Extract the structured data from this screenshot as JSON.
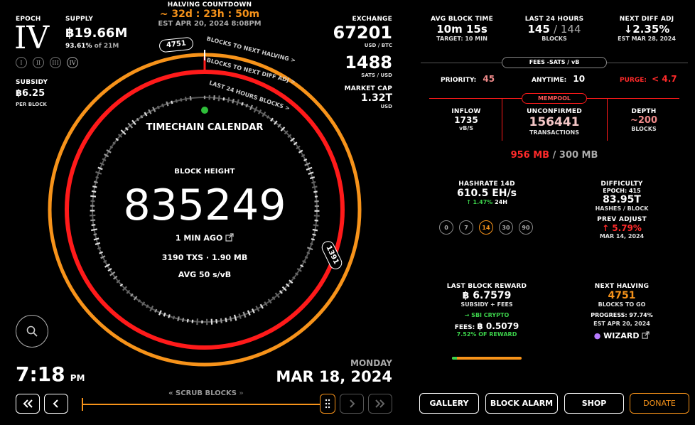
{
  "epoch": {
    "label": "EPOCH",
    "value": "IV",
    "badges": [
      "I",
      "II",
      "III",
      "IV"
    ]
  },
  "supply": {
    "label": "SUPPLY",
    "value": "฿19.66M",
    "pct": "93.61%",
    "of": "of 21M"
  },
  "subsidy": {
    "label": "SUBSIDY",
    "value": "฿6.25",
    "unit": "PER BLOCK"
  },
  "halving": {
    "label": "HALVING COUNTDOWN",
    "countdown": "~ 32d : 23h : 50m",
    "est": "EST APR 20, 2024 8:08PM"
  },
  "exchange": {
    "label": "EXCHANGE",
    "value": "67201",
    "unit": "USD / BTC",
    "sats": "1488",
    "sats_unit": "SATS / USD",
    "mcap_label": "MARKET CAP",
    "mcap": "1.32T",
    "mcap_unit": "USD"
  },
  "ring": {
    "title": "TIMECHAIN CALENDAR",
    "outer_label": "BLOCKS TO NEXT HALVING >",
    "outer_badge": "4751",
    "mid_label": "BLOCKS TO NEXT DIFF ADJ >",
    "mid_badge": "1391",
    "inner_label": "LAST 24 HOURS BLOCKS >"
  },
  "block": {
    "label": "BLOCK HEIGHT",
    "height": "835249",
    "ago": "1 MIN AGO",
    "txs": "3190 TXS · 1.90 MB",
    "avg": "AVG 50 s/vB"
  },
  "clock": {
    "time": "7:18",
    "ampm": "PM",
    "day": "MONDAY",
    "date": "MAR 18, 2024"
  },
  "scrub": {
    "label": "SCRUB BLOCKS"
  },
  "stats": {
    "avg_block_time": {
      "label": "AVG BLOCK TIME",
      "value": "10m 15s",
      "target": "TARGET: 10 MIN"
    },
    "last24": {
      "label": "LAST 24 HOURS",
      "value": "145",
      "sep": "/ 144",
      "unit": "BLOCKS"
    },
    "next_diff": {
      "label": "NEXT DIFF ADJ",
      "value": "↓2.35%",
      "est": "EST MAR 28, 2024"
    }
  },
  "fees": {
    "title": "FEES -SATS / vB",
    "priority_label": "PRIORITY:",
    "priority": "45",
    "anytime_label": "ANYTIME:",
    "anytime": "10",
    "purge_label": "PURGE:",
    "purge": "< 4.7"
  },
  "mempool": {
    "title": "MEMPOOL",
    "inflow_label": "INFLOW",
    "inflow": "1735",
    "inflow_unit": "vB/S",
    "unconf_label": "UNCONFIRMED",
    "unconf": "156441",
    "unconf_unit": "TRANSACTIONS",
    "depth_label": "DEPTH",
    "depth": "~200",
    "depth_unit": "BLOCKS",
    "size": "956 MB",
    "max": "/ 300 MB"
  },
  "hashrate": {
    "label": "HASHRATE 14D",
    "value": "610.5 EH/s",
    "change": "↑ 1.47%",
    "period": "24H",
    "options": [
      "0",
      "7",
      "14",
      "30",
      "90"
    ]
  },
  "difficulty": {
    "label": "DIFFICULTY",
    "epoch": "EPOCH: 415",
    "value": "83.95T",
    "unit": "HASHES / BLOCK",
    "prev_label": "PREV ADJUST",
    "prev": "↑ 5.79%",
    "prev_date": "MAR 14, 2024"
  },
  "reward": {
    "label": "LAST BLOCK REWARD",
    "value": "฿ 6.7579",
    "sub": "SUBSIDY + FEES",
    "pool": "→ SBI CRYPTO",
    "fees_label": "FEES:",
    "fees": "฿ 0.5079",
    "pct": "7.52% OF REWARD",
    "fee_fraction": 0.0752
  },
  "next_halving": {
    "label": "NEXT HALVING",
    "value": "4751",
    "unit": "BLOCKS TO GO",
    "progress_label": "PROGRESS:",
    "progress": "97.74%",
    "est": "EST APR 20, 2024",
    "wizard": "WIZARD"
  },
  "buttons": {
    "gallery": "GALLERY",
    "alarm": "BLOCK ALARM",
    "shop": "SHOP",
    "donate": "DONATE"
  },
  "colors": {
    "orange": "#f7931a",
    "red": "#ff1a1a",
    "green": "#3cd24b"
  }
}
